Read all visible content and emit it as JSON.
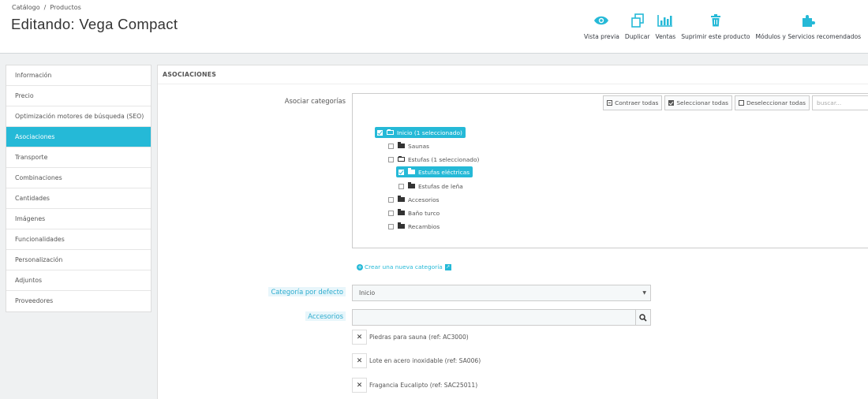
{
  "breadcrumb": {
    "parent": "Catálogo",
    "separator": "/",
    "current": "Productos"
  },
  "page_title": "Editando: Vega Compact",
  "toolbar": [
    {
      "label": "Vista previa",
      "icon": "eye-icon"
    },
    {
      "label": "Duplicar",
      "icon": "copy-icon"
    },
    {
      "label": "Ventas",
      "icon": "bar-chart-icon"
    },
    {
      "label": "Suprimir este producto",
      "icon": "trash-icon"
    },
    {
      "label": "Módulos y Servicios recomendados",
      "icon": "puzzle-icon"
    }
  ],
  "accent_color": "#25b9d7",
  "sidebar": {
    "active": "Asociaciones",
    "items": [
      {
        "label": "Información"
      },
      {
        "label": "Precio"
      },
      {
        "label": "Optimización motores de búsqueda (SEO)"
      },
      {
        "label": "Asociaciones"
      },
      {
        "label": "Transporte"
      },
      {
        "label": "Combinaciones"
      },
      {
        "label": "Cantidades"
      },
      {
        "label": "Imágenes"
      },
      {
        "label": "Funcionalidades"
      },
      {
        "label": "Personalización"
      },
      {
        "label": "Adjuntos"
      },
      {
        "label": "Proveedores"
      }
    ]
  },
  "panel": {
    "title": "ASOCIACIONES",
    "categories_label": "Asociar categorías",
    "tree_tools": {
      "collapse": "Contraer todas",
      "select_all": "Seleccionar todas",
      "deselect_all": "Deseleccionar todas",
      "search_placeholder": "buscar..."
    },
    "tree": [
      {
        "label": "Inicio (1 seleccionado)",
        "checked": true,
        "selected": true
      },
      {
        "label": "Saunas",
        "checked": false
      },
      {
        "label": "Estufas (1 seleccionado)",
        "checked": false
      },
      {
        "label": "Estufas eléctricas",
        "checked": true,
        "selected": true
      },
      {
        "label": "Estufas de leña",
        "checked": false
      },
      {
        "label": "Accesorios",
        "checked": false
      },
      {
        "label": "Baño turco",
        "checked": false
      },
      {
        "label": "Recambios",
        "checked": false
      }
    ],
    "new_category_link": "Crear una nueva categoría",
    "default_category_label": "Categoría por defecto",
    "default_category_value": "Inicio",
    "accessories_label": "Accesorios",
    "accessories": [
      {
        "label": "Piedras para sauna (ref: AC3000)"
      },
      {
        "label": "Lote en acero inoxidable (ref: SA006)"
      },
      {
        "label": "Fragancia Eucalipto (ref: SAC25011)"
      }
    ]
  }
}
